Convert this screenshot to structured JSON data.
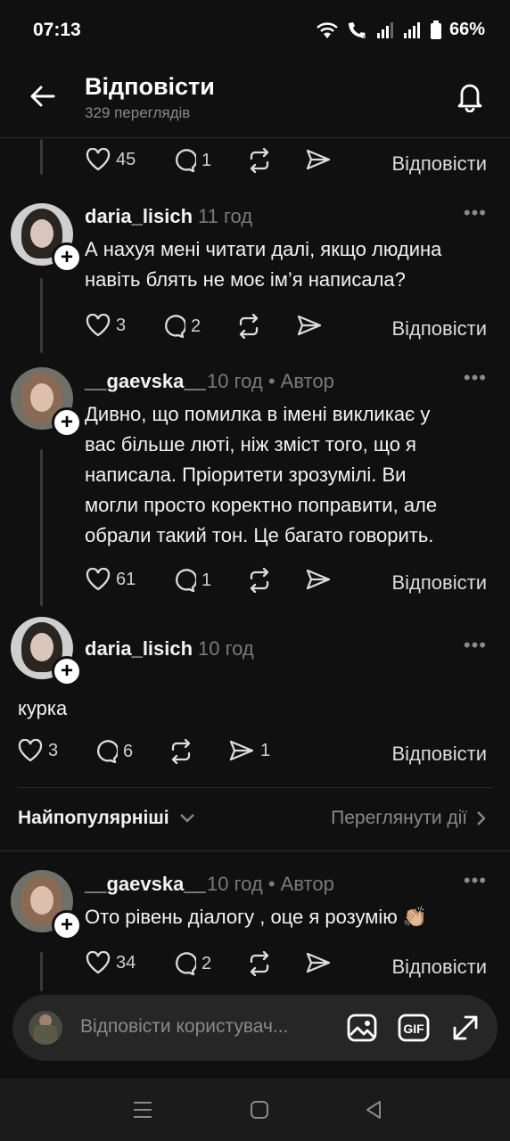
{
  "status": {
    "time": "07:13",
    "battery": "66%"
  },
  "header": {
    "title": "Відповісти",
    "subtitle": "329 переглядів"
  },
  "top_actions": {
    "likes": "45",
    "comments": "1",
    "reply": "Відповісти"
  },
  "comments": [
    {
      "user": "daria_lisich",
      "time": "11 год",
      "author": "",
      "lines": [
        "А нахуя мені читати далі, якщо людина",
        "навіть блять не моє ім’я написала?"
      ],
      "likes": "3",
      "comments": "2",
      "shares": "",
      "reply": "Відповісти"
    },
    {
      "user": "__gaevska__",
      "time": "10 год",
      "author": "• Автор",
      "lines": [
        "Дивно, що помилка в імені викликає у",
        "вас більше люті, ніж зміст того, що я",
        "написала. Пріоритети зрозумілі. Ви",
        "могли просто коректно поправити, але",
        "обрали такий тон. Це багато говорить."
      ],
      "likes": "61",
      "comments": "1",
      "shares": "",
      "reply": "Відповісти"
    },
    {
      "user": "daria_lisich",
      "time": "10 год",
      "author": "",
      "lines": [
        "курка"
      ],
      "likes": "3",
      "comments": "6",
      "shares": "1",
      "reply": "Відповісти"
    },
    {
      "user": "__gaevska__",
      "time": "10 год",
      "author": "• Автор",
      "lines": [
        "Ото рівень діалогу , оце я розумію 👏🏼"
      ],
      "likes": "34",
      "comments": "2",
      "shares": "",
      "reply": "Відповісти"
    }
  ],
  "sort": {
    "label": "Найпопулярніші",
    "view_activity": "Переглянути дії"
  },
  "composer": {
    "placeholder": "Відповісти користувач..."
  },
  "icons": [
    "back-arrow-icon",
    "bell-icon",
    "heart-icon",
    "comment-icon",
    "repost-icon",
    "send-icon",
    "more-dots-icon",
    "image-icon",
    "gif-icon",
    "expand-icon"
  ]
}
